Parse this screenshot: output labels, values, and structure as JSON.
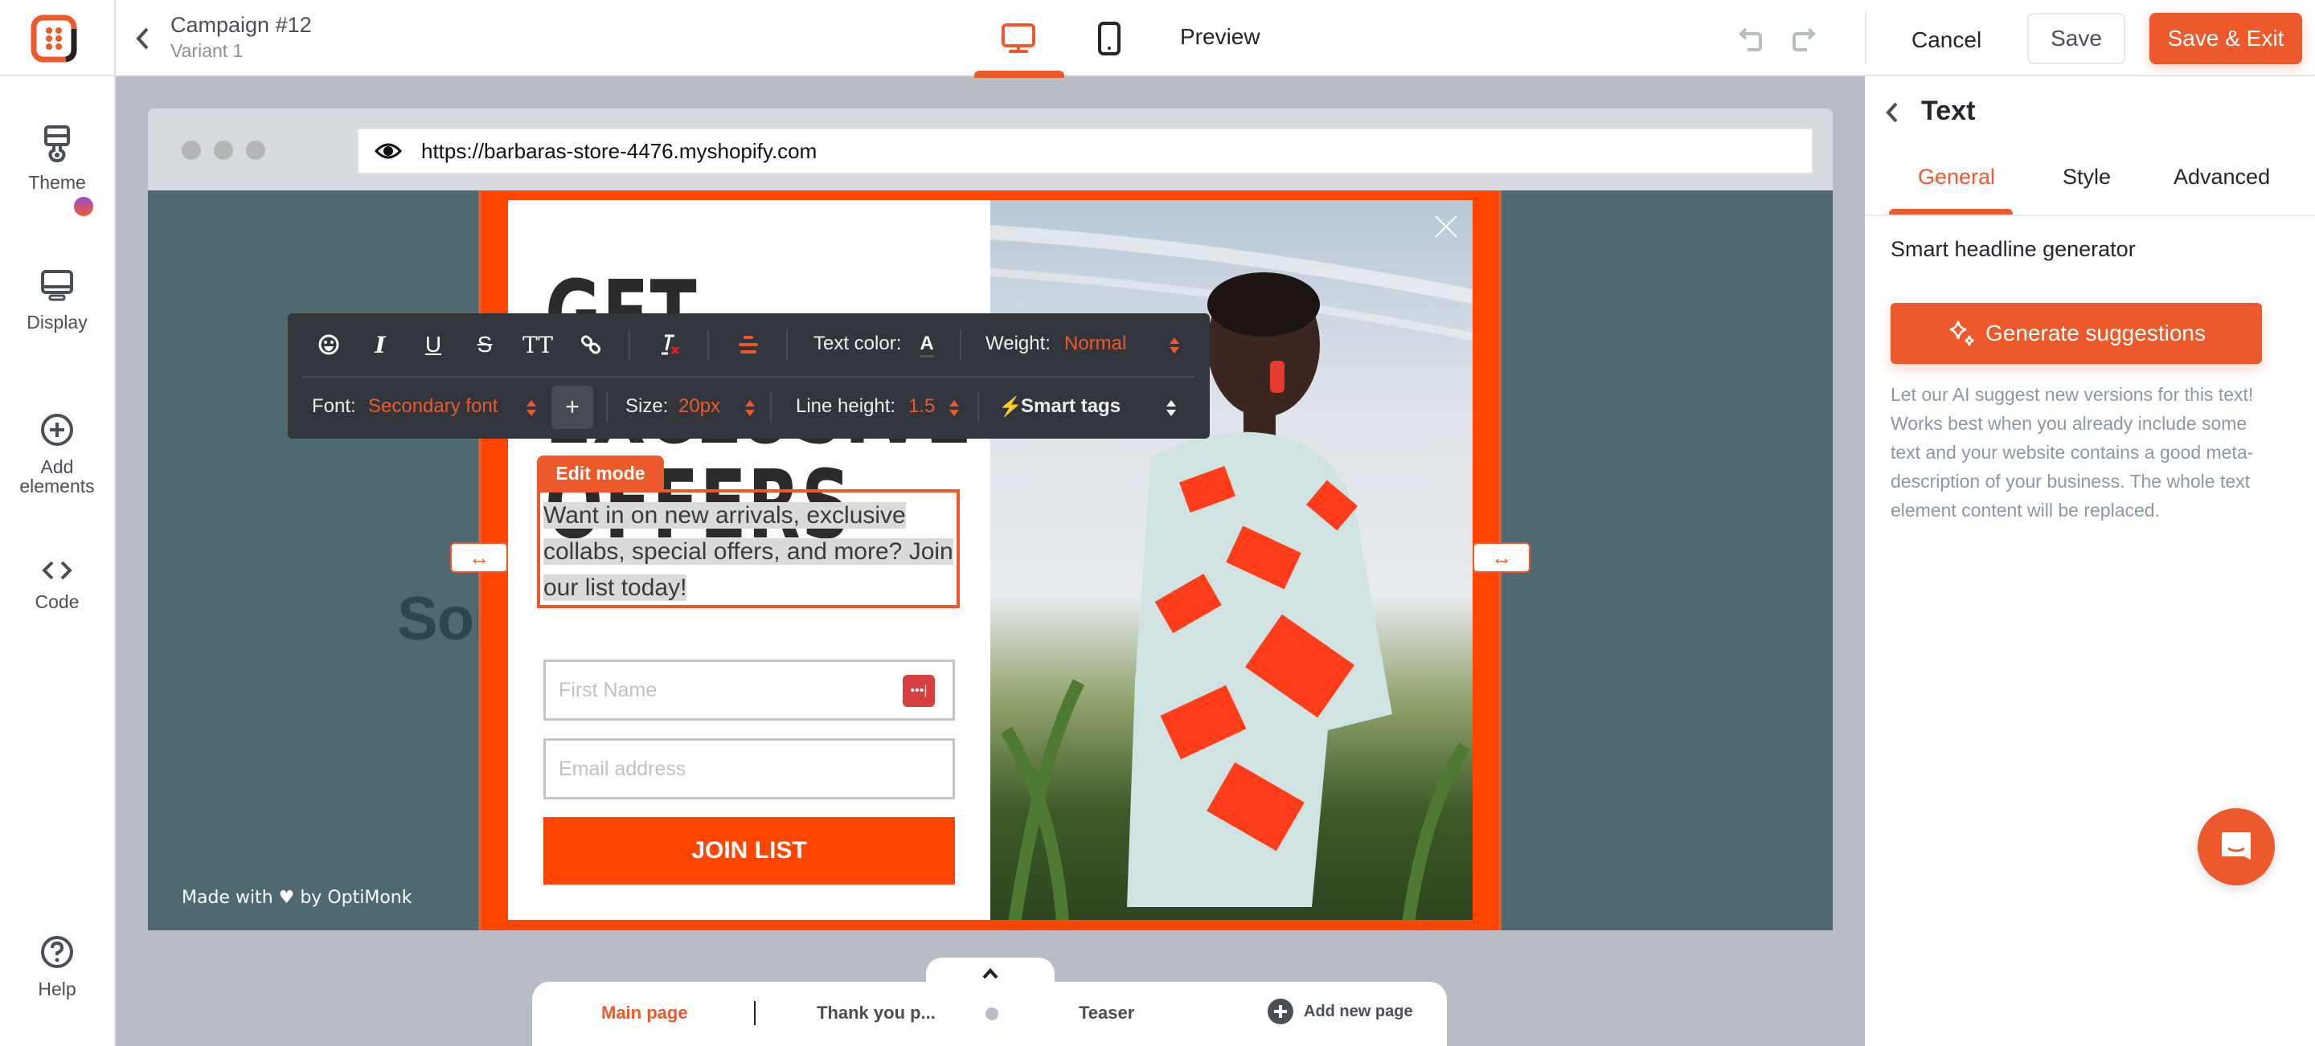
{
  "header": {
    "campaign_title": "Campaign #12",
    "variant": "Variant 1",
    "preview_label": "Preview",
    "cancel_label": "Cancel",
    "save_label": "Save",
    "save_exit_label": "Save & Exit",
    "active_device": "desktop"
  },
  "sidebar": {
    "items": [
      {
        "label": "Theme",
        "icon": "paint-brush-icon",
        "badge": true
      },
      {
        "label": "Display",
        "icon": "monitor-icon"
      },
      {
        "label": "Add elements",
        "icon": "plus-circle-icon"
      },
      {
        "label": "Code",
        "icon": "code-icon"
      },
      {
        "label": "Help",
        "icon": "help-circle-icon"
      }
    ]
  },
  "browser": {
    "url": "https://barbaras-store-4476.myshopify.com",
    "site_headline": "Some text for your people.",
    "made_with": "Made with ♥ by OptiMonk"
  },
  "popup": {
    "headline": "GET EXCLUSIVE OFFERS",
    "edit_mode_label": "Edit mode",
    "body_lines": [
      "Want in on new arrivals, exclusive",
      "collabs, special offers, and more? Join",
      "our list today!"
    ],
    "first_name_placeholder": "First Name",
    "email_placeholder": "Email address",
    "button_label": "JOIN LIST",
    "accent_color": "#ff4500"
  },
  "toolbar": {
    "text_color_label": "Text color:",
    "weight_label": "Weight:",
    "weight_value": "Normal",
    "font_label": "Font:",
    "font_value": "Secondary font",
    "size_label": "Size:",
    "size_value": "20px",
    "line_height_label": "Line height:",
    "line_height_value": "1.5",
    "smart_tags_label": "Smart tags",
    "tt_label": "TT"
  },
  "right_panel": {
    "title": "Text",
    "tabs": [
      "General",
      "Style",
      "Advanced"
    ],
    "active_tab": "General",
    "section_title": "Smart headline generator",
    "generate_label": "Generate suggestions",
    "description": "Let our AI suggest new versions for this text! Works best when you already include some text and your website contains a good meta-description of your business. The whole text element content will be replaced."
  },
  "pages": {
    "items": [
      "Main page",
      "Thank you p...",
      "Teaser"
    ],
    "active": "Main page",
    "add_label": "Add new page"
  },
  "colors": {
    "brand": "#ec5a2b",
    "site_bg": "#4f6970",
    "toolbar_bg": "#32353b"
  }
}
